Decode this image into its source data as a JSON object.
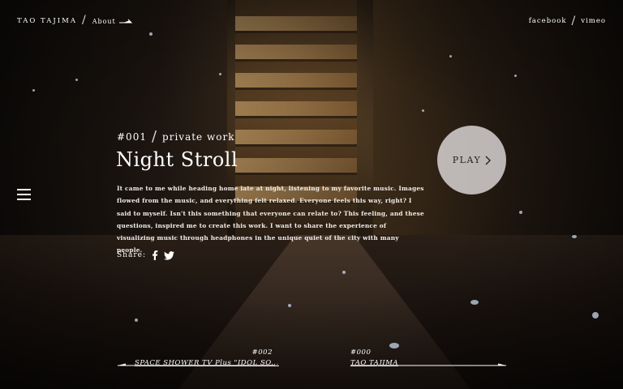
{
  "header": {
    "brand": "TAO TAJIMA",
    "about": "About",
    "social": [
      "facebook",
      "vimeo"
    ]
  },
  "work": {
    "number": "#001",
    "category": "private work",
    "title": "Night Stroll",
    "description": "It came to me while heading home late at night, listening to my favorite music. Images flowed from the music, and everything felt relaxed. Everyone feels this way, right? I said to myself. Isn't this something that everyone can relate to? This feeling, and these questions, inspired me to create this work. I want to share the experience of visualizing music through headphones in the unique quiet of the city with many people.",
    "share_label": "Share:",
    "play_label": "PLAY"
  },
  "navigation": {
    "prev": {
      "number": "#002",
      "title": "SPACE SHOWER TV Plus \"IDOL SO..."
    },
    "next": {
      "number": "#000",
      "title": "TAO TAJIMA"
    }
  },
  "icons": [
    "arrow-right-icon",
    "menu-icon",
    "facebook-icon",
    "twitter-icon",
    "chevron-right-icon"
  ],
  "colors": {
    "text": "#ffffff",
    "play_button": "#d7d2d2",
    "play_text": "#222222"
  }
}
